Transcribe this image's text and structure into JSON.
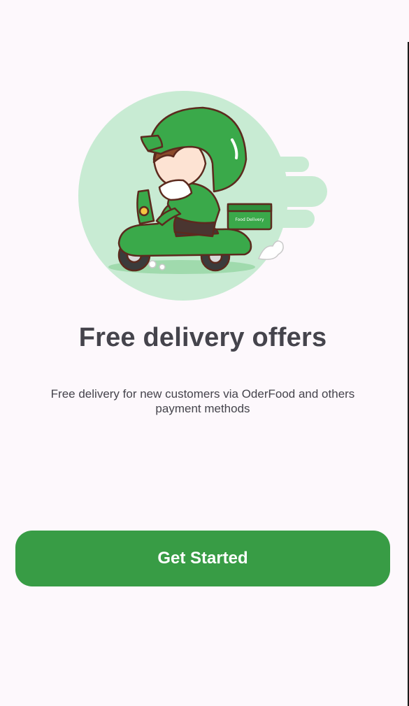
{
  "onboarding": {
    "illustration_icon": "delivery-scooter-rider-illustration",
    "box_text": "Food Delivery",
    "title": "Free delivery offers",
    "subtitle": "Free delivery for new customers via OderFood and others payment methods",
    "cta_label": "Get Started"
  },
  "colors": {
    "background": "#fdf8fc",
    "accent": "#389c45",
    "illustration_circle": "#c8ebd3",
    "text": "#45444c"
  }
}
